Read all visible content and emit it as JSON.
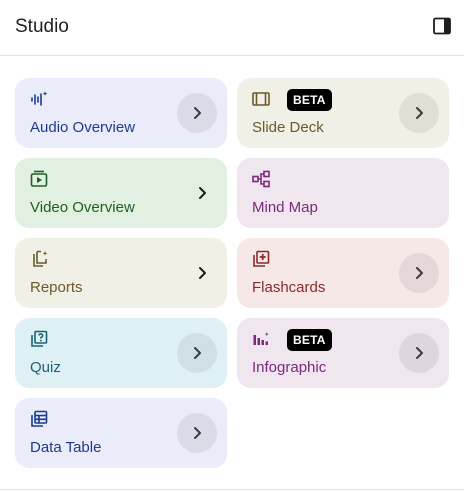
{
  "header": {
    "title": "Studio",
    "panel_toggle_icon": "dock-panel-icon"
  },
  "tiles": [
    {
      "id": "audio-overview",
      "label": "Audio Overview",
      "icon": "audio-wave-sparkle-icon",
      "bg": "#eaecf9",
      "fg": "#1c3a8f"
    },
    {
      "id": "slide-deck",
      "label": "Slide Deck",
      "icon": "slides-icon",
      "badge": "BETA",
      "bg": "#f1f0e6",
      "fg": "#6b5a2a"
    },
    {
      "id": "video-overview",
      "label": "Video Overview",
      "icon": "video-play-icon",
      "bg": "#e2f0e2",
      "fg": "#1f5e24"
    },
    {
      "id": "mind-map",
      "label": "Mind Map",
      "icon": "mind-map-icon",
      "bg": "#f0e6f0",
      "fg": "#7a2a78"
    },
    {
      "id": "reports",
      "label": "Reports",
      "icon": "report-sparkle-icon",
      "bg": "#f1f0e6",
      "fg": "#6b5a2a"
    },
    {
      "id": "flashcards",
      "label": "Flashcards",
      "icon": "flashcards-icon",
      "bg": "#f7e8e8",
      "fg": "#8a2a2a"
    },
    {
      "id": "quiz",
      "label": "Quiz",
      "icon": "quiz-icon",
      "bg": "#dff0f5",
      "fg": "#1a6272"
    },
    {
      "id": "infographic",
      "label": "Infographic",
      "icon": "infographic-bars-icon",
      "badge": "BETA",
      "bg": "#f0e6f0",
      "fg": "#7a2a78"
    },
    {
      "id": "data-table",
      "label": "Data Table",
      "icon": "table-icon",
      "bg": "#eaecf9",
      "fg": "#1c3a8f"
    }
  ],
  "chevron_style": {
    "audio-overview": "circle",
    "slide-deck": "circle",
    "video-overview": "plain",
    "mind-map": "none",
    "reports": "plain",
    "flashcards": "circle",
    "quiz": "circle",
    "infographic": "circle",
    "data-table": "circle"
  }
}
